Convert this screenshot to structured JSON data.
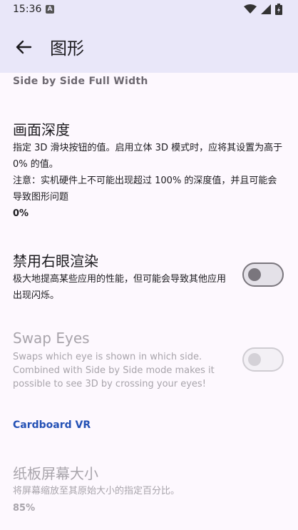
{
  "status": {
    "time": "15:36",
    "notif_icon": "A"
  },
  "appbar": {
    "title": "图形"
  },
  "prev_item": {
    "value": "Side by Side Full Width"
  },
  "depth": {
    "title": "画面深度",
    "desc1": "指定 3D 滑块按钮的值。启用立体 3D 模式时，应将其设置为高于 0% 的值。",
    "desc2": "注意：实机硬件上不可能出现超过 100% 的深度值，并且可能会导致图形问题",
    "value": "0%"
  },
  "disable_right_eye": {
    "title": "禁用右眼渲染",
    "desc": "极大地提高某些应用的性能，但可能会导致其他应用出现闪烁。",
    "enabled": false
  },
  "swap_eyes": {
    "title": "Swap Eyes",
    "desc": "Swaps which eye is shown in which side. Combined with Side by Side mode makes it possible to see 3D by crossing your eyes!",
    "enabled": false
  },
  "section_cardboard": {
    "label": "Cardboard VR"
  },
  "cardboard_size": {
    "title": "纸板屏幕大小",
    "desc": "将屏幕缩放至其原始大小的指定百分比。",
    "value": "85%"
  }
}
